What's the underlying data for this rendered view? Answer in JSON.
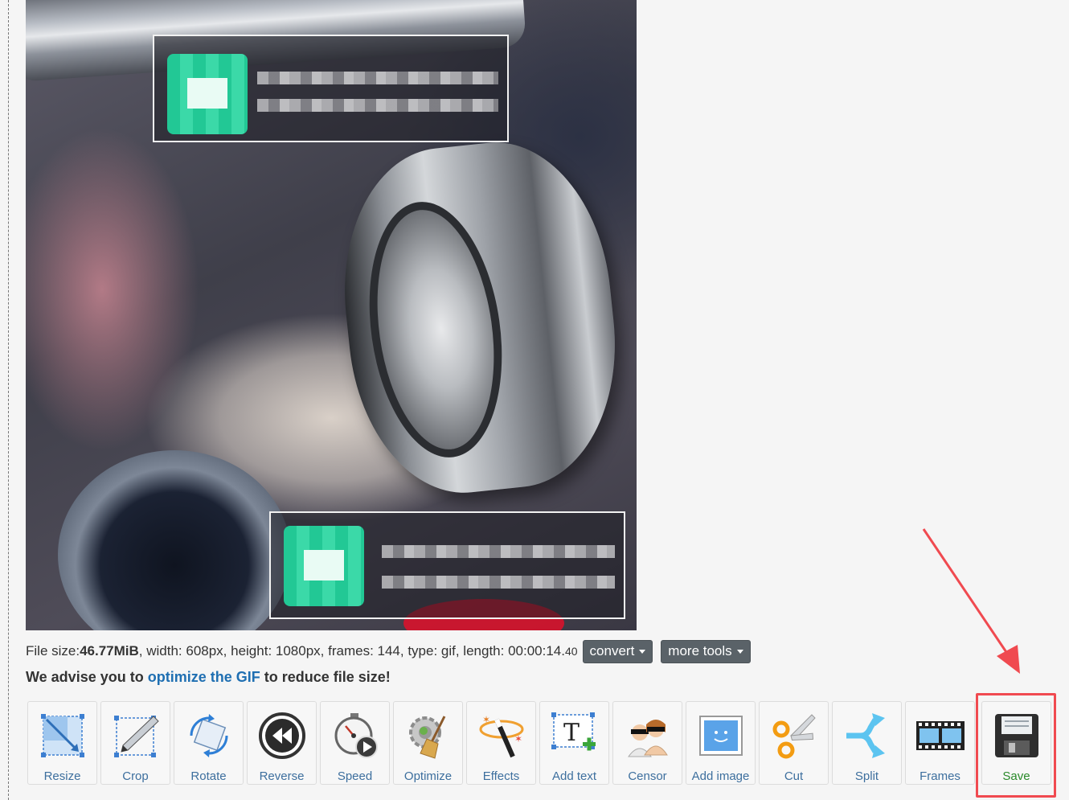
{
  "file_info": {
    "file_size_label": "File size: ",
    "file_size_value": "46.77MiB",
    "details": ", width: 608px, height: 1080px, frames: 144, type: gif, length: 00:00:14.",
    "length_fraction": "40"
  },
  "buttons": {
    "convert": "convert",
    "more_tools": "more tools"
  },
  "advice": {
    "prefix": "We advise you to ",
    "link": "optimize the GIF",
    "suffix": " to reduce file size!"
  },
  "toolbar": {
    "tools": [
      {
        "label": "Resize",
        "icon": "resize-icon"
      },
      {
        "label": "Crop",
        "icon": "crop-icon"
      },
      {
        "label": "Rotate",
        "icon": "rotate-icon"
      },
      {
        "label": "Reverse",
        "icon": "reverse-icon"
      },
      {
        "label": "Speed",
        "icon": "speed-icon"
      },
      {
        "label": "Optimize",
        "icon": "optimize-icon"
      },
      {
        "label": "Effects",
        "icon": "effects-icon"
      },
      {
        "label": "Add text",
        "icon": "add-text-icon"
      },
      {
        "label": "Censor",
        "icon": "censor-icon"
      },
      {
        "label": "Add image",
        "icon": "add-image-icon"
      },
      {
        "label": "Cut",
        "icon": "cut-icon"
      },
      {
        "label": "Split",
        "icon": "split-icon"
      },
      {
        "label": "Frames",
        "icon": "frames-icon"
      },
      {
        "label": "Save",
        "icon": "save-icon"
      }
    ]
  },
  "colors": {
    "link": "#1f6fb2",
    "tool_label": "#3d6f9e",
    "save_label": "#2a8a2a",
    "highlight": "#f04a50",
    "dropdown_bg": "#5a6268"
  }
}
